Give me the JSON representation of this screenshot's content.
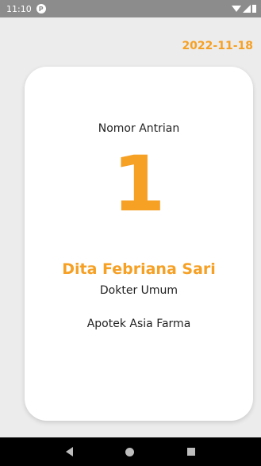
{
  "status_bar": {
    "time": "11:10",
    "badge": "P"
  },
  "header": {
    "date": "2022-11-18"
  },
  "card": {
    "queue_label": "Nomor Antrian",
    "queue_number": "1",
    "doctor_name": "Dita Febriana Sari",
    "doctor_specialty": "Dokter Umum",
    "pharmacy": "Apotek Asia Farma"
  },
  "colors": {
    "accent": "#f6a024",
    "status_bar": "#8c8c8c",
    "nav_bar": "#000000"
  },
  "icons": {
    "wifi": "wifi-icon",
    "signal": "signal-icon",
    "back": "back-icon",
    "home": "home-icon",
    "recent": "recent-apps-icon"
  }
}
